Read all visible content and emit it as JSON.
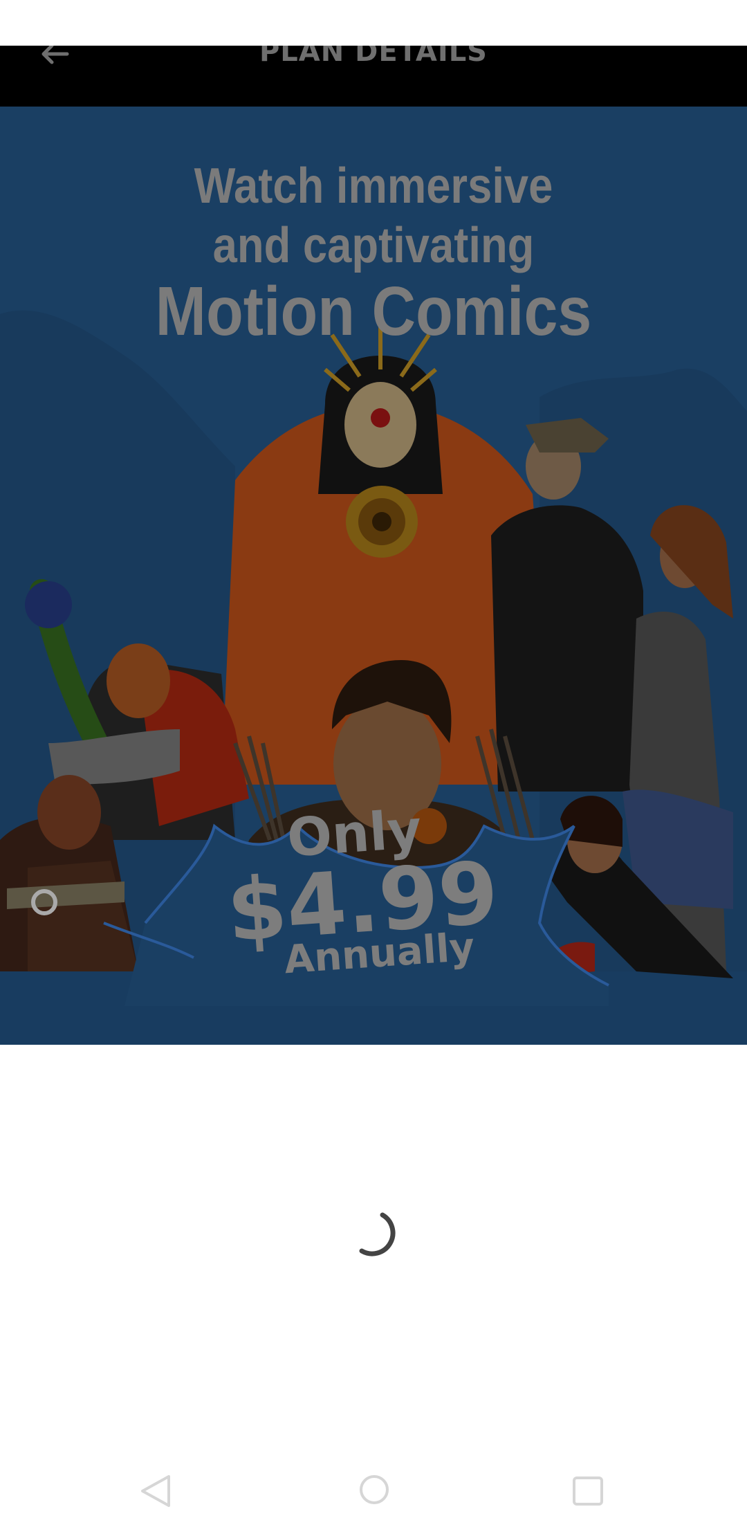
{
  "app_bar": {
    "title": "PLAN DETAILS",
    "back_icon": "arrow-left-icon"
  },
  "banner": {
    "headline_line1": "Watch immersive",
    "headline_line2": "and captivating",
    "headline_line3": "Motion Comics",
    "price_prefix": "Only",
    "price_amount": "$4.99",
    "price_period": "Annually"
  },
  "loading": {
    "icon": "loading-spinner-icon"
  },
  "navigation": {
    "back_icon": "nav-back-icon",
    "home_icon": "nav-home-icon",
    "recents_icon": "nav-recents-icon"
  },
  "colors": {
    "app_bar": "#000000",
    "banner_background": "#1a3f63",
    "text_dimmed": "#7b7b7b",
    "spinner": "#444444"
  }
}
